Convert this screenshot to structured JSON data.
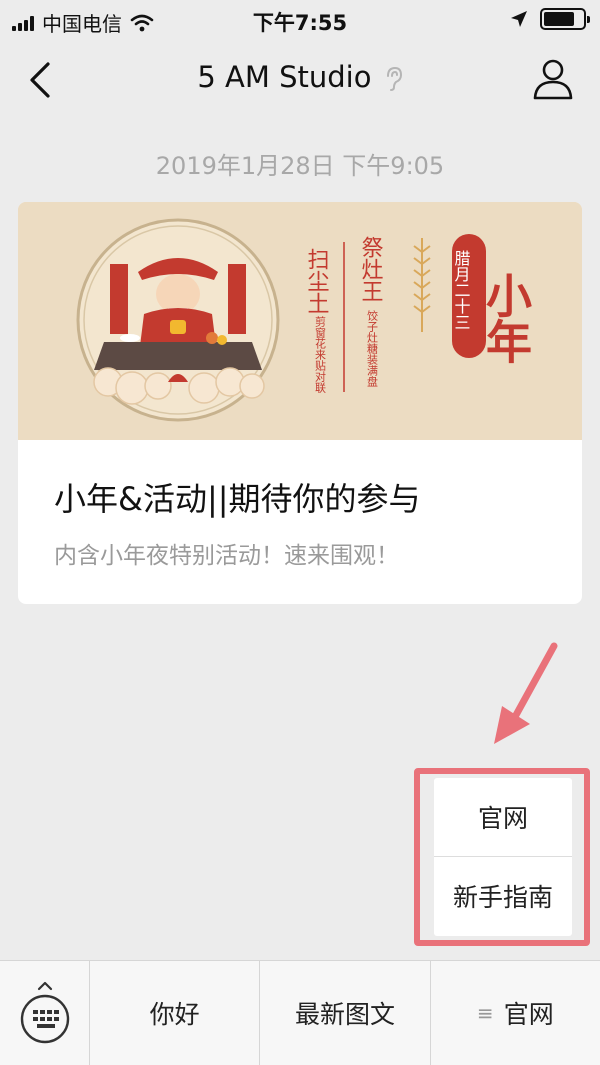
{
  "status_bar": {
    "carrier": "中国电信",
    "time": "下午7:55",
    "signal_bars": 4,
    "battery_level": 0.8
  },
  "nav": {
    "title": "5 AM Studio",
    "back_icon": "chevron-left-icon",
    "profile_icon": "person-icon",
    "listen_icon": "ear-icon"
  },
  "chat": {
    "timestamp": "2019年1月28日 下午9:05"
  },
  "article": {
    "cover": {
      "big_title": "小年",
      "date_label": "腊月二十三",
      "col1_title": "扫尘土",
      "col1_sub": "剪窗花来贴对联",
      "col2_title": "祭灶王",
      "col2_sub": "饺子灶糖装满盘"
    },
    "title": "小年&活动||期待你的参与",
    "description": "内含小年夜特别活动！速来围观！"
  },
  "popup_menu": {
    "items": [
      {
        "label": "官网"
      },
      {
        "label": "新手指南"
      }
    ],
    "highlight_color": "#e9727a"
  },
  "menu_bar": {
    "keyboard_icon": "keyboard-icon",
    "tabs": [
      {
        "label": "你好"
      },
      {
        "label": "最新图文"
      },
      {
        "label": "官网",
        "icon": "menu-lines-icon"
      }
    ]
  }
}
